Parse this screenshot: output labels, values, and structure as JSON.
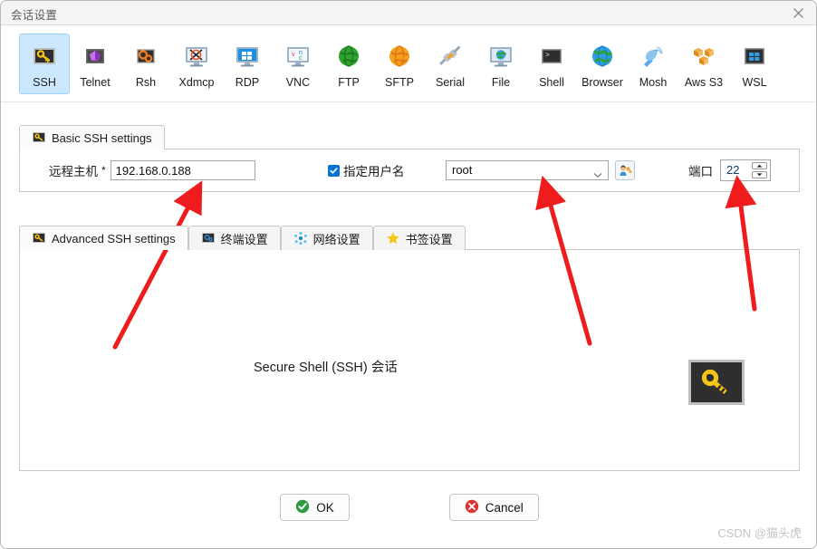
{
  "window": {
    "title": "会话设置",
    "close_icon": "close-icon"
  },
  "protocols": [
    {
      "id": "ssh",
      "label": "SSH",
      "icon": "ssh-key-icon",
      "selected": true
    },
    {
      "id": "telnet",
      "label": "Telnet",
      "icon": "telnet-icon",
      "selected": false
    },
    {
      "id": "rsh",
      "label": "Rsh",
      "icon": "rsh-gears-icon",
      "selected": false
    },
    {
      "id": "xdmcp",
      "label": "Xdmcp",
      "icon": "xdmcp-icon",
      "selected": false
    },
    {
      "id": "rdp",
      "label": "RDP",
      "icon": "rdp-icon",
      "selected": false
    },
    {
      "id": "vnc",
      "label": "VNC",
      "icon": "vnc-icon",
      "selected": false
    },
    {
      "id": "ftp",
      "label": "FTP",
      "icon": "ftp-globe-icon",
      "selected": false
    },
    {
      "id": "sftp",
      "label": "SFTP",
      "icon": "sftp-globe-icon",
      "selected": false
    },
    {
      "id": "serial",
      "label": "Serial",
      "icon": "serial-plug-icon",
      "selected": false
    },
    {
      "id": "file",
      "label": "File",
      "icon": "file-monitor-icon",
      "selected": false
    },
    {
      "id": "shell",
      "label": "Shell",
      "icon": "shell-prompt-icon",
      "selected": false
    },
    {
      "id": "browser",
      "label": "Browser",
      "icon": "browser-globe-icon",
      "selected": false
    },
    {
      "id": "mosh",
      "label": "Mosh",
      "icon": "mosh-dish-icon",
      "selected": false
    },
    {
      "id": "awss3",
      "label": "Aws S3",
      "icon": "aws-s3-icon",
      "selected": false
    },
    {
      "id": "wsl",
      "label": "WSL",
      "icon": "wsl-windows-icon",
      "selected": false
    }
  ],
  "basic": {
    "tab_label": "Basic SSH settings",
    "tab_icon": "key-icon",
    "host_label": "远程主机",
    "host_required_mark": "*",
    "host_value": "192.168.0.188",
    "host_placeholder": "",
    "specify_username_label": "指定用户名",
    "specify_username_checked": true,
    "username_value": "root",
    "user_button_icon": "user-key-icon",
    "port_label": "端口",
    "port_value": "22"
  },
  "advanced_tabs": [
    {
      "id": "advanced",
      "label": "Advanced SSH settings",
      "icon": "key-icon",
      "active": true
    },
    {
      "id": "terminal",
      "label": "终端设置",
      "icon": "gear-blue-icon",
      "active": false
    },
    {
      "id": "network",
      "label": "网络设置",
      "icon": "network-icon",
      "active": false
    },
    {
      "id": "bookmark",
      "label": "书签设置",
      "icon": "star-icon",
      "active": false
    }
  ],
  "panel": {
    "caption": "Secure Shell (SSH) 会话",
    "badge_icon": "ssh-key-badge-icon"
  },
  "footer": {
    "ok_label": "OK",
    "ok_icon": "check-circle-icon",
    "cancel_label": "Cancel",
    "cancel_icon": "x-circle-icon"
  },
  "watermark": {
    "text": "CSDN @猫头虎"
  },
  "colors": {
    "selection_bg": "#cce8ff",
    "selection_border": "#99d1ff",
    "checkbox_blue": "#0a72d4",
    "annotation_red": "#ee1c1c",
    "ok_green": "#2e9b3f",
    "cancel_red": "#e03131",
    "key_yellow": "#f5c518"
  },
  "annotations": [
    {
      "id": "arrow-host",
      "points_to": "host-input"
    },
    {
      "id": "arrow-username",
      "points_to": "username-combo"
    },
    {
      "id": "arrow-port",
      "points_to": "port-spinner"
    }
  ]
}
